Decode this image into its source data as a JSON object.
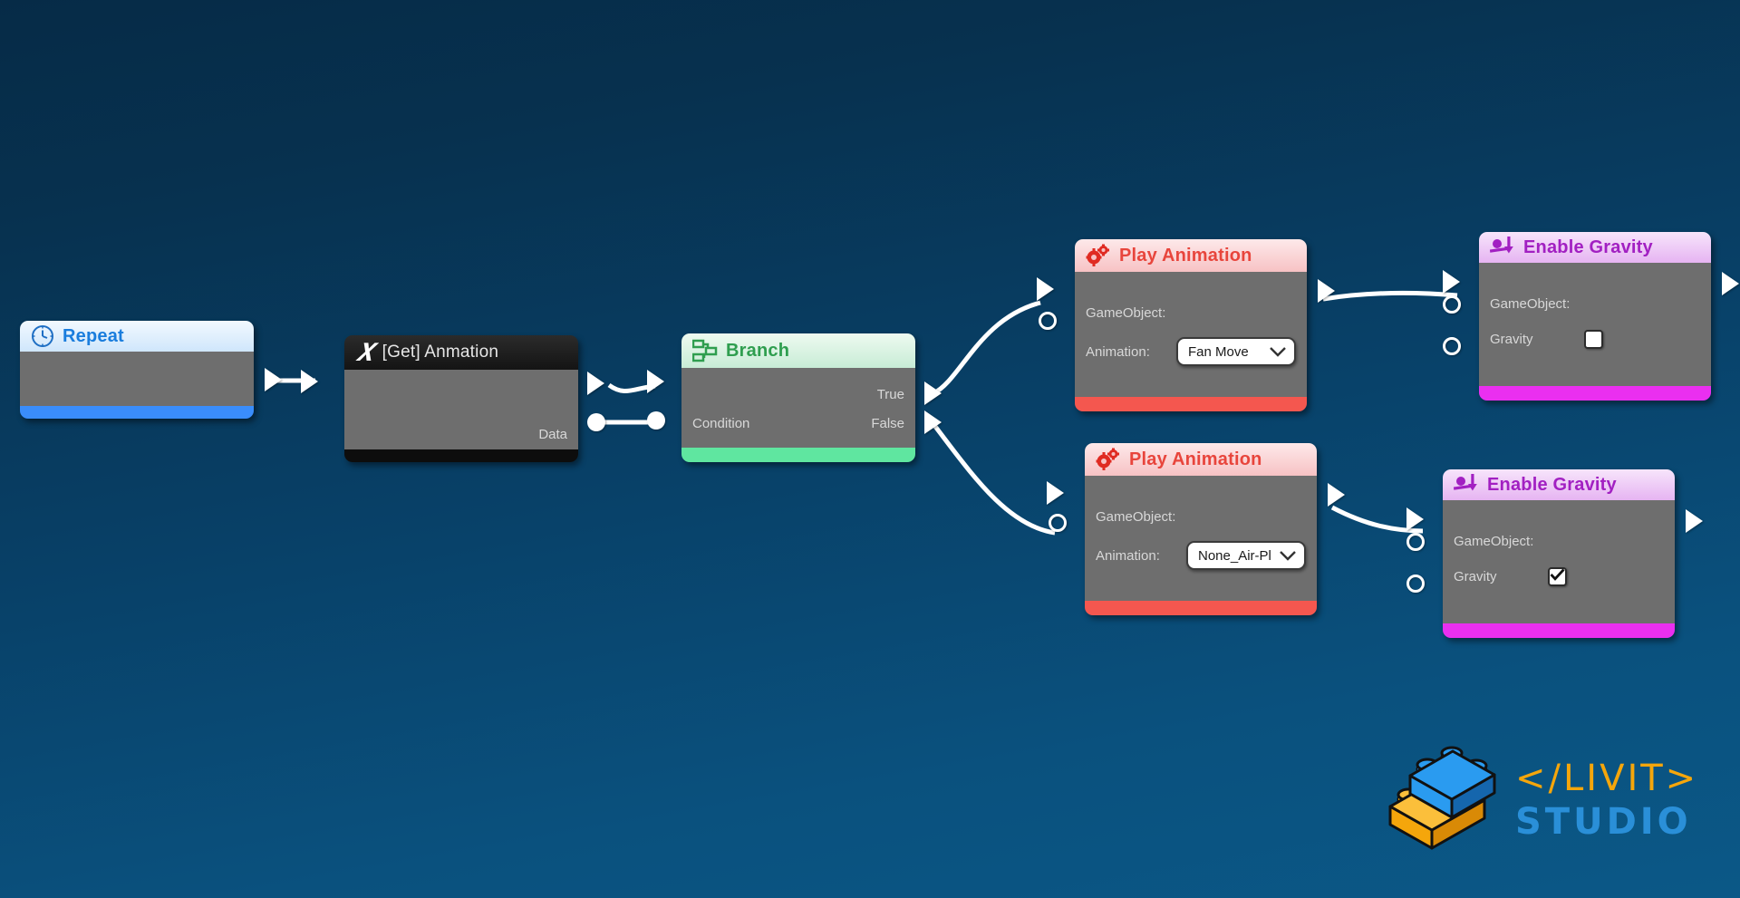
{
  "app": {
    "background_top": "#062b47",
    "background_bottom": "#0b5887"
  },
  "logo": {
    "brick_icon": "lego-brick-icon",
    "wordmark_top": "</LIVIT>",
    "wordmark_bottom": "STUDIO",
    "color_top": "#f5a60b",
    "color_bottom": "#2a8fd8"
  },
  "nodes": [
    {
      "id": "repeat",
      "title": "Repeat",
      "icon": "clock-icon",
      "header_color": "#1a7ddd",
      "footer_color": "#3a8dfb",
      "ports": {
        "flow_in": true,
        "flow_out": true
      },
      "rows": []
    },
    {
      "id": "get_animation",
      "title": "[Get] Anmation",
      "icon": "variable-x-icon",
      "header_color": "#1a1a1a",
      "footer_color": "#0d0d0d",
      "ports": {
        "data_out": true
      },
      "rows": [
        {
          "label": "",
          "right": "Data"
        }
      ]
    },
    {
      "id": "branch",
      "title": "Branch",
      "icon": "branch-flow-icon",
      "header_color": "#2f9e4f",
      "footer_color": "#5fe6a0",
      "ports": {
        "flow_in": true,
        "data_in": true,
        "flow_out_true": true,
        "flow_out_false": true
      },
      "rows": [
        {
          "label": "",
          "right": "True"
        },
        {
          "label": "Condition",
          "right": "False"
        }
      ]
    },
    {
      "id": "play_animation_true",
      "title": "Play Animation",
      "icon": "gears-icon",
      "header_color": "#e8453c",
      "footer_color": "#f4574f",
      "ports": {
        "flow_in": true,
        "obj_in": true,
        "flow_out": true
      },
      "rows": [
        {
          "label": "GameObject:",
          "right": ""
        },
        {
          "label": "Animation:",
          "control": "dropdown",
          "value": "Fan Move"
        }
      ]
    },
    {
      "id": "play_animation_false",
      "title": "Play Animation",
      "icon": "gears-icon",
      "header_color": "#e8453c",
      "footer_color": "#f4574f",
      "ports": {
        "flow_in": true,
        "obj_in": true,
        "flow_out": true
      },
      "rows": [
        {
          "label": "GameObject:",
          "right": ""
        },
        {
          "label": "Animation:",
          "control": "dropdown",
          "value": "None_Air-Pl"
        }
      ]
    },
    {
      "id": "enable_gravity_true",
      "title": "Enable Gravity",
      "icon": "gravity-icon",
      "header_color": "#a220c2",
      "footer_color": "#ea2ff0",
      "ports": {
        "flow_in": true,
        "obj_in": true,
        "bool_in": true,
        "flow_out": true
      },
      "rows": [
        {
          "label": "GameObject:",
          "right": ""
        },
        {
          "label": "Gravity",
          "control": "checkbox",
          "checked": false
        }
      ]
    },
    {
      "id": "enable_gravity_false",
      "title": "Enable Gravity",
      "icon": "gravity-icon",
      "header_color": "#a220c2",
      "footer_color": "#ea2ff0",
      "ports": {
        "flow_in": true,
        "obj_in": true,
        "bool_in": true,
        "flow_out": true
      },
      "rows": [
        {
          "label": "GameObject:",
          "right": ""
        },
        {
          "label": "Gravity",
          "control": "checkbox",
          "checked": true
        }
      ]
    }
  ],
  "labels": {
    "repeat_title": "Repeat",
    "get_animation_title": "[Get] Anmation",
    "get_animation_data": "Data",
    "branch_title": "Branch",
    "branch_true": "True",
    "branch_false": "False",
    "branch_condition": "Condition",
    "play_animation_title": "Play Animation",
    "gameobject": "GameObject:",
    "animation": "Animation:",
    "anim_value_true": "Fan Move",
    "anim_value_false": "None_Air-Pl",
    "enable_gravity_title": "Enable Gravity",
    "gravity": "Gravity"
  }
}
